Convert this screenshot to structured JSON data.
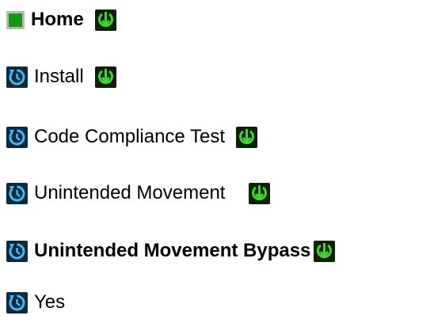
{
  "menu": {
    "items": [
      {
        "label": "Home",
        "bold": true,
        "left_icon": "home-square-icon",
        "right_icon": "down-arrow-icon"
      },
      {
        "label": "Install",
        "bold": false,
        "left_icon": "refresh-icon",
        "right_icon": "down-arrow-icon"
      },
      {
        "label": "Code Compliance Test",
        "bold": false,
        "left_icon": "refresh-icon",
        "right_icon": "down-arrow-icon"
      },
      {
        "label": "Unintended Movement",
        "bold": false,
        "left_icon": "refresh-icon",
        "right_icon": "down-arrow-icon"
      },
      {
        "label": "Unintended Movement Bypass",
        "bold": true,
        "left_icon": "refresh-icon",
        "right_icon": "down-arrow-icon"
      },
      {
        "label": "Yes",
        "bold": false,
        "left_icon": "refresh-icon",
        "right_icon": null
      }
    ]
  },
  "colors": {
    "home_square": "#149814",
    "refresh_icon_bg": "#0b2a3a",
    "refresh_icon_fg": "#44b8ff",
    "down_icon_bg": "#101f08",
    "down_icon_fg": "#3cd82a"
  }
}
